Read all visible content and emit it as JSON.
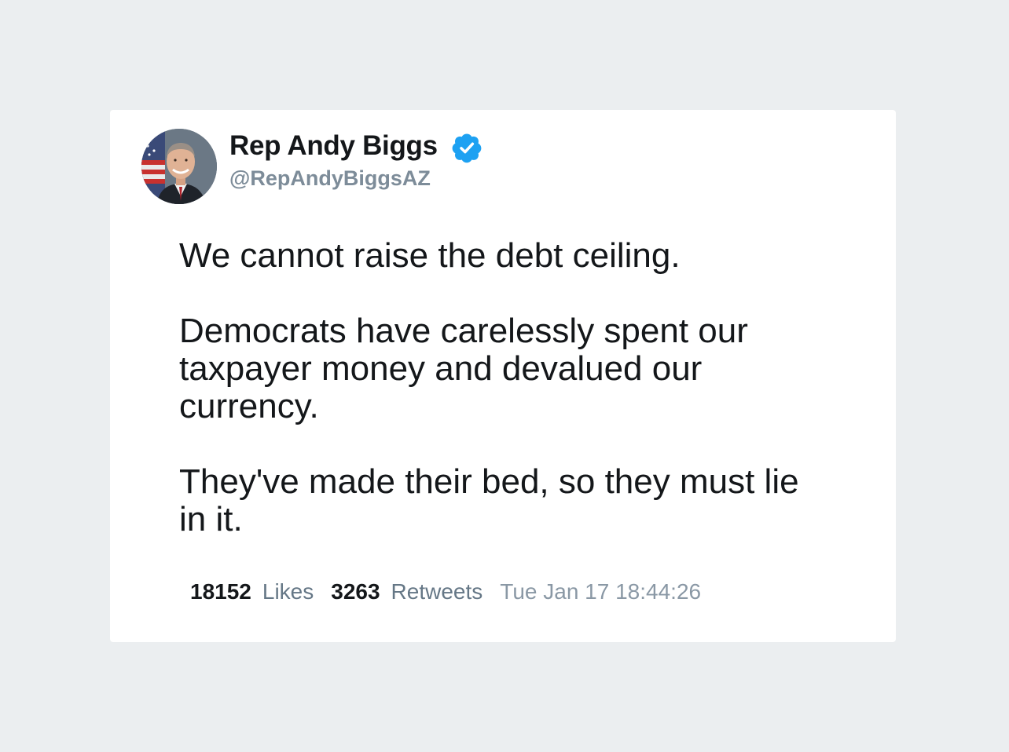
{
  "tweet": {
    "author": {
      "display_name": "Rep Andy Biggs",
      "handle": "@RepAndyBiggsAZ",
      "verified": true,
      "avatar_icon": "profile-photo",
      "verified_icon": "verified-badge-icon"
    },
    "body": {
      "paragraphs": [
        "We cannot raise the debt ceiling.",
        "Democrats have carelessly spent our taxpayer money and devalued our currency.",
        "They've made their bed, so they must lie in it."
      ]
    },
    "stats": {
      "likes_count": "18152",
      "likes_label": "Likes",
      "retweets_count": "3263",
      "retweets_label": "Retweets",
      "timestamp": "Tue Jan 17 18:44:26"
    }
  },
  "colors": {
    "page_background": "#ebeef0",
    "card_background": "#ffffff",
    "verified_blue": "#1da1f2",
    "primary_text": "#14171a",
    "secondary_text": "#657786"
  }
}
